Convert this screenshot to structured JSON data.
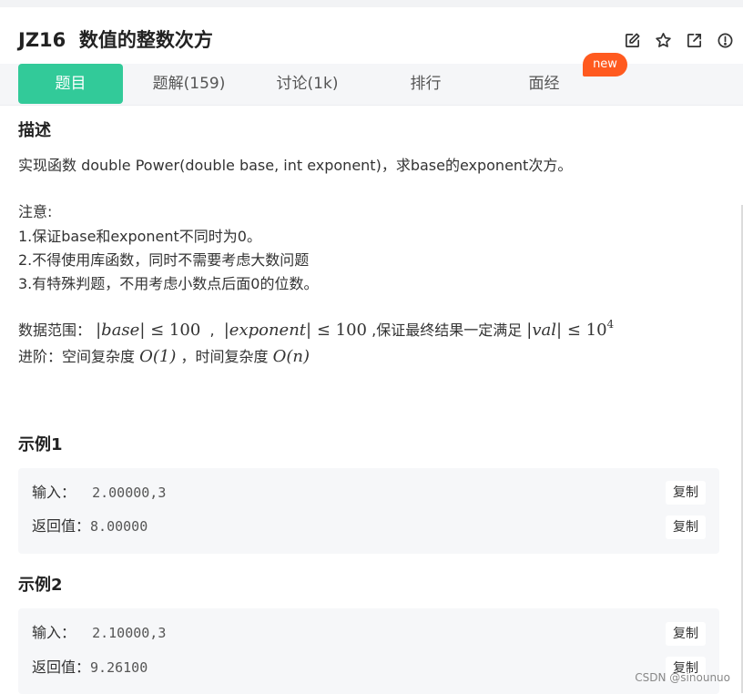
{
  "problem": {
    "title": "JZ16  数值的整数次方"
  },
  "toolbar": {
    "icons": [
      "edit-icon",
      "star-icon",
      "external-link-icon",
      "info-icon"
    ]
  },
  "tabs": [
    "题目",
    "题解(159)",
    "讨论(1k)",
    "排行",
    "面经"
  ],
  "new_badge": "new",
  "description": {
    "heading": "描述",
    "intro": "实现函数 double Power(double base, int exponent)，求base的exponent次方。",
    "note_title": "注意:",
    "notes": [
      "1.保证base和exponent不同时为0。",
      "2.不得使用库函数，同时不需要考虑大数问题",
      "3.有特殊判题，不用考虑小数点后面0的位数。"
    ],
    "range_label": "数据范围：",
    "range_base": "|base|",
    "range_base_bound": "≤ 100",
    "range_exp": "|exponent|",
    "range_exp_bound": "≤ 100",
    "range_guarantee": ",保证最终结果一定满足",
    "range_val": "|val|",
    "range_val_bound_base": "≤ 10",
    "range_val_bound_exp": "4",
    "advanced_label": "进阶：空间复杂度",
    "space_complexity": "O(1)",
    "time_label": "，时间复杂度",
    "time_complexity": "O(n)"
  },
  "examples": [
    {
      "heading": "示例1",
      "input_label": "输入：",
      "input": "  2.00000,3",
      "output_label": "返回值：",
      "output": "8.00000",
      "copy_label": "复制"
    },
    {
      "heading": "示例2",
      "input_label": "输入：",
      "input": "  2.10000,3",
      "output_label": "返回值：",
      "output": "9.26100",
      "copy_label": "复制"
    }
  ],
  "watermark": "CSDN @sinounuo"
}
